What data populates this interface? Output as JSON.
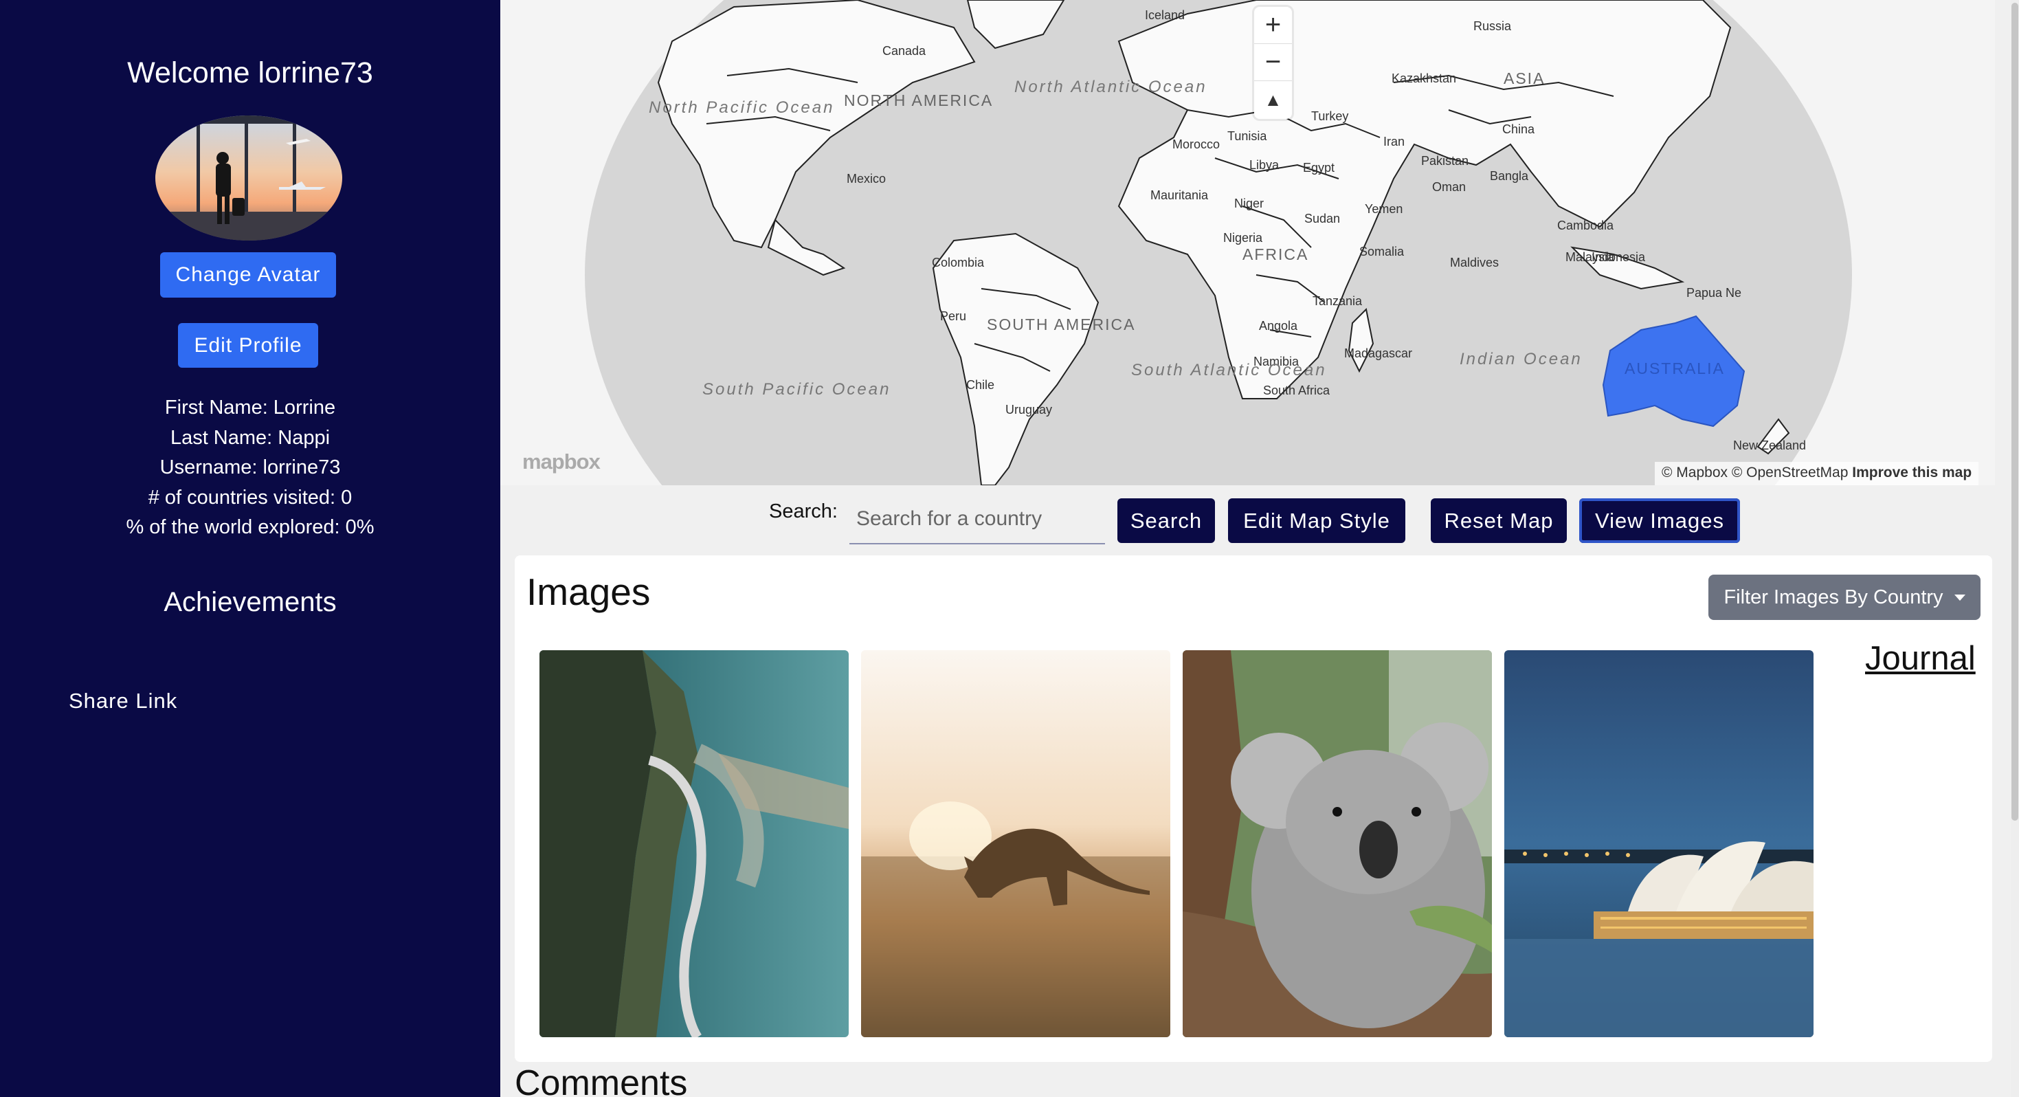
{
  "sidebar": {
    "welcome": "Welcome lorrine73",
    "change_avatar": "Change Avatar",
    "edit_profile": "Edit Profile",
    "info": [
      "First Name: Lorrine",
      "Last Name: Nappi",
      "Username: lorrine73",
      "# of countries visited: 0",
      "% of the world explored: 0%"
    ],
    "achievements": "Achievements",
    "share_link": "Share Link"
  },
  "map": {
    "labels": {
      "canada": "Canada",
      "north_america": "NORTH AMERICA",
      "north_pacific": "North Pacific Ocean",
      "north_atlantic": "North Atlantic Ocean",
      "south_pacific": "South Pacific Ocean",
      "south_atlantic": "South Atlantic Ocean",
      "indian_ocean": "Indian Ocean",
      "south_america": "SOUTH AMERICA",
      "africa": "AFRICA",
      "asia": "ASIA",
      "australia": "AUSTRALIA",
      "russia": "Russia",
      "china": "China",
      "kazakhstan": "Kazakhstan",
      "iran": "Iran",
      "turkey": "Turkey",
      "libya": "Libya",
      "egypt": "Egypt",
      "niger": "Niger",
      "sudan": "Sudan",
      "somalia": "Somalia",
      "tanzania": "Tanzania",
      "angola": "Angola",
      "namibia": "Namibia",
      "south_africa": "South Africa",
      "madagascar": "Madagascar",
      "mauritania": "Mauritania",
      "morocco": "Morocco",
      "tunisia": "Tunisia",
      "mexico": "Mexico",
      "colombia": "Colombia",
      "peru": "Peru",
      "chile": "Chile",
      "uruguay": "Uruguay",
      "maldives": "Maldives",
      "oman": "Oman",
      "pakistan": "Pakistan",
      "bangladesh": "Bangla",
      "indonesia": "Indonesia",
      "papua": "Papua Ne",
      "new_zealand": "New Zealand",
      "iceland": "Iceland",
      "yemen": "Yemen",
      "nigeria": "Nigeria",
      "cambodia": "Cambodia",
      "malaysia": "Malaysia"
    },
    "highlight_color": "#3d73f0",
    "zoom_in": "+",
    "zoom_out": "−",
    "compass": "▲",
    "mapbox_logo": "mapbox",
    "attribution": "© Mapbox © OpenStreetMap",
    "improve": "Improve this map"
  },
  "search": {
    "label": "Search:",
    "placeholder": "Search for a country",
    "search_btn": "Search",
    "edit_style_btn": "Edit Map Style",
    "reset_btn": "Reset Map",
    "view_images_btn": "View Images"
  },
  "images": {
    "title": "Images",
    "filter_btn": "Filter Images By Country",
    "journal": "Journal",
    "thumbs": [
      "coastal-road-photo",
      "kangaroo-photo",
      "koala-photo",
      "opera-house-photo"
    ]
  },
  "comments": {
    "title": "Comments"
  },
  "colors": {
    "sidebar_bg": "#0a0a45",
    "primary_button": "#2f6bf2",
    "dark_button": "#0a0a45"
  }
}
